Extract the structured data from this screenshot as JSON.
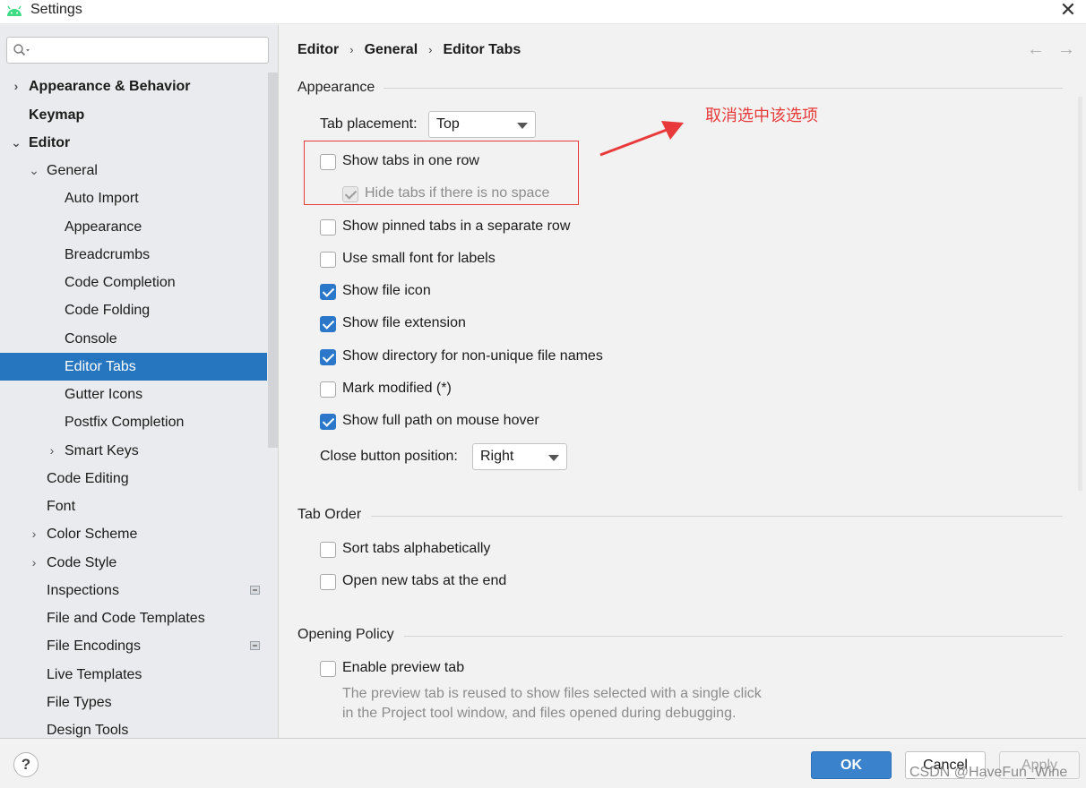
{
  "window": {
    "title": "Settings",
    "close_glyph": "✕"
  },
  "sidebar": {
    "search": {
      "value": "",
      "placeholder": ""
    },
    "items": [
      {
        "label": "Appearance & Behavior",
        "arrow": "›",
        "bold": true
      },
      {
        "label": "Keymap",
        "bold": true
      },
      {
        "label": "Editor",
        "arrow": "⌄",
        "bold": true
      },
      {
        "label": "General",
        "arrow": "⌄"
      },
      {
        "label": "Auto Import"
      },
      {
        "label": "Appearance"
      },
      {
        "label": "Breadcrumbs"
      },
      {
        "label": "Code Completion"
      },
      {
        "label": "Code Folding"
      },
      {
        "label": "Console"
      },
      {
        "label": "Editor Tabs",
        "selected": true
      },
      {
        "label": "Gutter Icons"
      },
      {
        "label": "Postfix Completion"
      },
      {
        "label": "Smart Keys",
        "arrow": "›"
      },
      {
        "label": "Code Editing"
      },
      {
        "label": "Font"
      },
      {
        "label": "Color Scheme",
        "arrow": "›"
      },
      {
        "label": "Code Style",
        "arrow": "›"
      },
      {
        "label": "Inspections",
        "badge": true
      },
      {
        "label": "File and Code Templates"
      },
      {
        "label": "File Encodings",
        "badge": true
      },
      {
        "label": "Live Templates"
      },
      {
        "label": "File Types"
      },
      {
        "label": "Design Tools"
      }
    ]
  },
  "breadcrumb": {
    "items": [
      "Editor",
      "General",
      "Editor Tabs"
    ],
    "separator": "›",
    "back_glyph": "←",
    "forward_glyph": "→"
  },
  "sections": {
    "appearance": {
      "title": "Appearance",
      "tab_placement_label": "Tab placement:",
      "tab_placement_value": "Top",
      "show_tabs_one_row": {
        "label": "Show tabs in one row",
        "checked": false
      },
      "hide_tabs_no_space": {
        "label": "Hide tabs if there is no space",
        "checked": true,
        "disabled": true
      },
      "show_pinned_separate": {
        "label": "Show pinned tabs in a separate row",
        "checked": false
      },
      "small_font": {
        "label": "Use small font for labels",
        "checked": false
      },
      "show_file_icon": {
        "label": "Show file icon",
        "checked": true
      },
      "show_file_extension": {
        "label": "Show file extension",
        "checked": true
      },
      "show_directory": {
        "label": "Show directory for non-unique file names",
        "checked": true
      },
      "mark_modified": {
        "label": "Mark modified (*)",
        "checked": false
      },
      "show_full_path": {
        "label": "Show full path on mouse hover",
        "checked": true
      },
      "close_button_label": "Close button position:",
      "close_button_value": "Right"
    },
    "tab_order": {
      "title": "Tab Order",
      "sort_alpha": {
        "label": "Sort tabs alphabetically",
        "checked": false
      },
      "open_at_end": {
        "label": "Open new tabs at the end",
        "checked": false
      }
    },
    "opening_policy": {
      "title": "Opening Policy",
      "enable_preview": {
        "label": "Enable preview tab",
        "checked": false
      },
      "preview_help_line1": "The preview tab is reused to show files selected with a single click",
      "preview_help_line2": "in the Project tool window, and files opened during debugging."
    }
  },
  "annotation": {
    "text": "取消选中该选项",
    "color": "#e83a3a"
  },
  "footer": {
    "help_label": "?",
    "ok_label": "OK",
    "cancel_label": "Cancel",
    "apply_label": "Apply",
    "watermark": "CSDN @HaveFun_Wine"
  },
  "colors": {
    "accent": "#2675bf",
    "checkbox_checked": "#2b77c9",
    "ok_button": "#3b82cc",
    "annotation": "#e83a3a"
  }
}
